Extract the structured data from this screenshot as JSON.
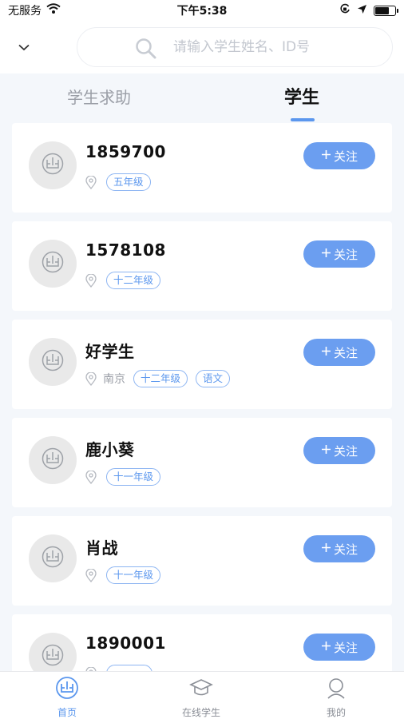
{
  "status_bar": {
    "carrier": "无服务",
    "time": "下午5:38",
    "battery_level": 0.7
  },
  "search": {
    "placeholder": "请输入学生姓名、ID号"
  },
  "tabs": [
    {
      "label": "学生求助",
      "active": false
    },
    {
      "label": "学生",
      "active": true
    }
  ],
  "follow_label": "关注",
  "students": [
    {
      "name": "1859700",
      "location": "",
      "tags": [
        "五年级"
      ]
    },
    {
      "name": "1578108",
      "location": "",
      "tags": [
        "十二年级"
      ]
    },
    {
      "name": "好学生",
      "location": "南京",
      "tags": [
        "十二年级",
        "语文"
      ]
    },
    {
      "name": "鹿小葵",
      "location": "",
      "tags": [
        "十一年级"
      ]
    },
    {
      "name": "肖战",
      "location": "",
      "tags": [
        "十一年级"
      ]
    },
    {
      "name": "1890001",
      "location": "",
      "tags": [
        ""
      ]
    }
  ],
  "bottom_nav": [
    {
      "label": "首页",
      "icon": "home-icon",
      "active": true
    },
    {
      "label": "在线学生",
      "icon": "graduation-cap-icon",
      "active": false
    },
    {
      "label": "我的",
      "icon": "user-icon",
      "active": false
    }
  ],
  "colors": {
    "accent": "#5b97ee",
    "button": "#6b9ef0",
    "tag_border": "#8db5f2",
    "background": "#f4f7fb"
  }
}
